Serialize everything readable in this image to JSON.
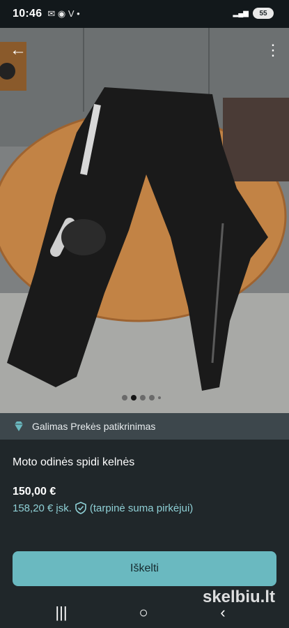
{
  "status_bar": {
    "time": "10:46",
    "icons": "✉ ◉ V •",
    "battery": "55"
  },
  "photo": {
    "alt": "Leather motorcycle pants on a wooden table",
    "page_count": 5,
    "active_page": 1
  },
  "verification": {
    "label": "Galimas Prekės patikrinimas"
  },
  "listing": {
    "title": "Moto odinės spidi kelnės",
    "price": "150,00 €",
    "price_incl": "158,20 €",
    "price_incl_suffix": "įsk.",
    "price_note": "(tarpinė suma pirkėjui)"
  },
  "cta": {
    "label": "Iškelti"
  },
  "watermark": "skelbiu.lt",
  "colors": {
    "accent": "#6ab9c0",
    "bg": "#20272a",
    "banner": "#3d474c"
  }
}
